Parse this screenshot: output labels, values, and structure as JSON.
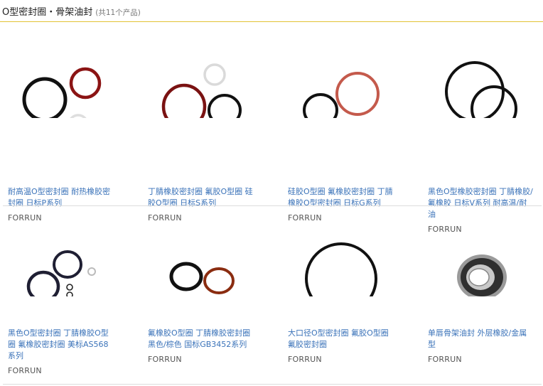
{
  "header": {
    "title": "O型密封圈・骨架油封",
    "count": "(共11个产品)"
  },
  "products": [
    {
      "name": "耐高温O型密封圈 耐热橡胶密封圈 日标P系列",
      "brand": "FORRUN",
      "image": "three-rings-black-red-white"
    },
    {
      "name": "丁腈橡胶密封圈 氟胶O型圈 硅胶O型圈 日标S系列",
      "brand": "FORRUN",
      "image": "three-rings-red-black-white"
    },
    {
      "name": "硅胶O型圈 氟橡胶密封圈 丁腈橡胶O型密封圈 日标G系列",
      "brand": "FORRUN",
      "image": "two-rings-black-pink"
    },
    {
      "name": "黑色O型橡胶密封圈 丁腈橡胶/氟橡胶 日标V系列 耐高温/耐油",
      "brand": "FORRUN",
      "image": "three-black-rings"
    },
    {
      "name": "黑色O型密封圈 丁腈橡胶O型圈 氟橡胶密封圈 美标AS568系列",
      "brand": "FORRUN",
      "image": "assorted-dark-rings"
    },
    {
      "name": "氟橡胶O型圈 丁腈橡胶密封圈 黑色/棕色 国标GB3452系列",
      "brand": "FORRUN",
      "image": "two-rings-black-brown"
    },
    {
      "name": "大口径O型密封圈 氟胶O型圈 氟胶密封圈",
      "brand": "FORRUN",
      "image": "large-black-ring"
    },
    {
      "name": "单唇骨架油封 外层橡胶/金属型",
      "brand": "FORRUN",
      "image": "oil-seal"
    }
  ]
}
